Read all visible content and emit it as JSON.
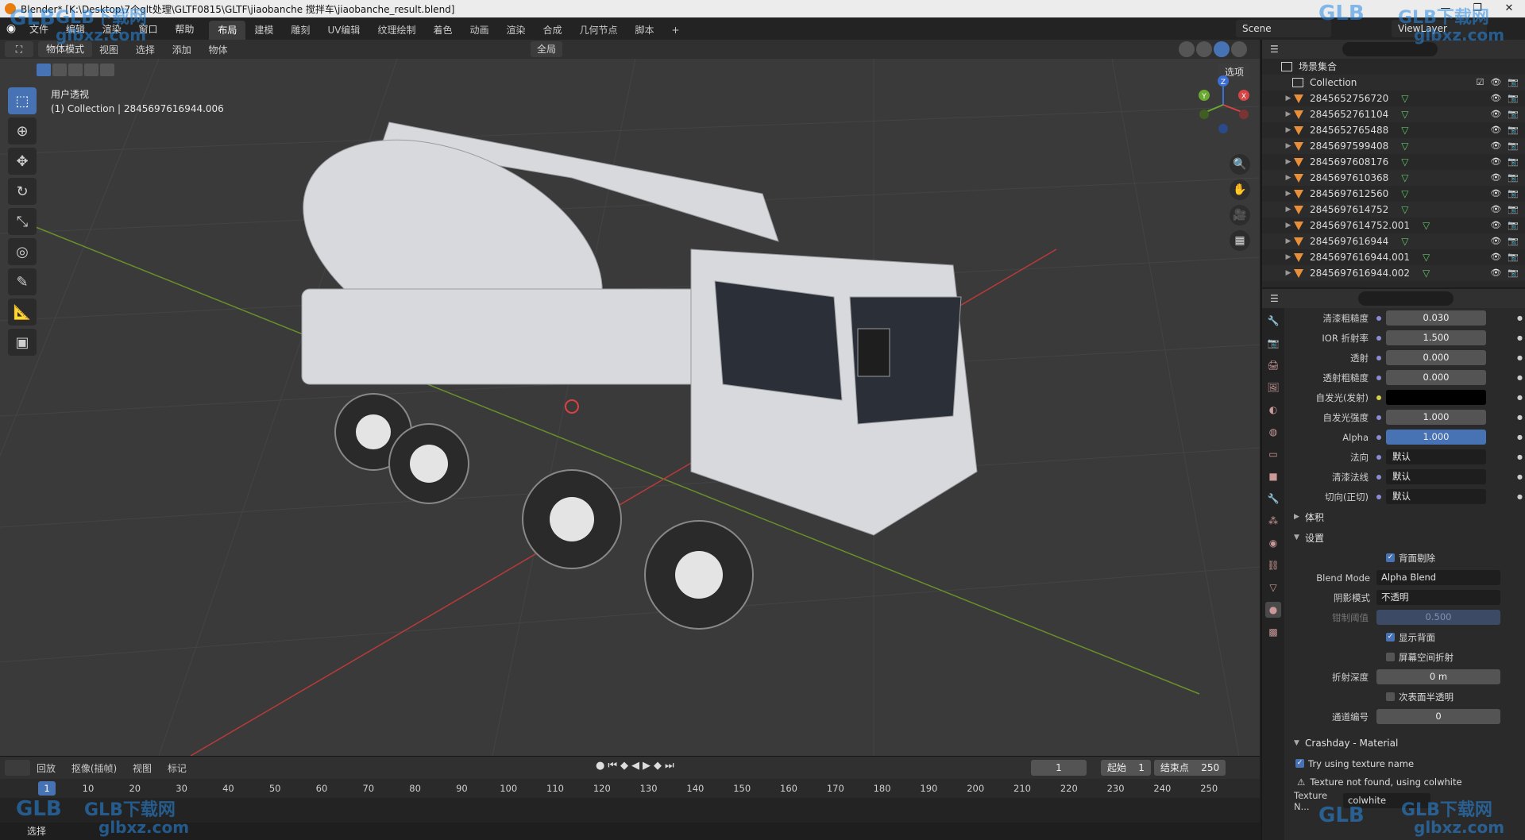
{
  "window": {
    "title": "Blender* [K:\\Desktop\\7个glt处理\\GLTF0815\\GLTF\\jiaobanche 搅拌车\\jiaobanche_result.blend]",
    "controls": [
      "—",
      "❐",
      "✕"
    ]
  },
  "topbar": {
    "menu": [
      "文件",
      "编辑",
      "渲染",
      "窗口",
      "帮助"
    ],
    "workspaces": [
      "布局",
      "建模",
      "雕刻",
      "UV编辑",
      "纹理绘制",
      "着色",
      "动画",
      "渲染",
      "合成",
      "几何节点",
      "脚本"
    ],
    "active_workspace": "布局",
    "add_tab": "+",
    "scene": "Scene",
    "view_layer": "ViewLayer"
  },
  "viewport_header": {
    "mode": "物体模式",
    "menu": [
      "视图",
      "选择",
      "添加",
      "物体"
    ],
    "transform_orientation": "全局",
    "options": "选项"
  },
  "viewport": {
    "view_name": "用户透视",
    "collection_info": "(1) Collection | 2845697616944.006",
    "gizmo_axes": [
      "X",
      "Y",
      "Z"
    ],
    "toolbar_icons": [
      "select-box-icon",
      "cursor-icon",
      "move-icon",
      "rotate-icon",
      "scale-icon",
      "transform-icon",
      "annotate-icon",
      "measure-icon",
      "add-cube-icon"
    ],
    "nav_icons": [
      "🔍",
      "✋",
      "🎥",
      "▦"
    ]
  },
  "outliner": {
    "root": "场景集合",
    "collection": "Collection",
    "items": [
      "2845652756720",
      "2845652761104",
      "2845652765488",
      "2845697599408",
      "2845697608176",
      "2845697610368",
      "2845697612560",
      "2845697614752",
      "2845697614752.001",
      "2845697616944",
      "2845697616944.001",
      "2845697616944.002"
    ]
  },
  "properties": {
    "fields": [
      {
        "label": "清漆粗糙度",
        "value": "0.030",
        "style": "grey"
      },
      {
        "label": "IOR 折射率",
        "value": "1.500",
        "style": "grey"
      },
      {
        "label": "透射",
        "value": "0.000",
        "style": "grey"
      },
      {
        "label": "透射粗糙度",
        "value": "0.000",
        "style": "grey"
      },
      {
        "label": "自发光(发射)",
        "value": "",
        "style": "black"
      },
      {
        "label": "自发光强度",
        "value": "1.000",
        "style": "grey"
      },
      {
        "label": "Alpha",
        "value": "1.000",
        "style": "blue"
      },
      {
        "label": "法向",
        "value": "默认",
        "style": "dark"
      },
      {
        "label": "清漆法线",
        "value": "默认",
        "style": "dark"
      },
      {
        "label": "切向(正切)",
        "value": "默认",
        "style": "dark"
      }
    ],
    "section_volume": "体积",
    "section_settings": "设置",
    "backface_culling": "背面剔除",
    "blend_mode_label": "Blend Mode",
    "blend_mode_value": "Alpha Blend",
    "shadow_mode_label": "阴影模式",
    "shadow_mode_value": "不透明",
    "clip_threshold_label": "钳制阈值",
    "clip_threshold_value": "0.500",
    "show_backface": "显示背面",
    "screen_space_refraction": "屏幕空间折射",
    "refraction_depth_label": "折射深度",
    "refraction_depth_value": "0 m",
    "subsurface_translucency": "次表面半透明",
    "pass_index_label": "通道编号",
    "pass_index_value": "0",
    "crashday_section": "Crashday - Material",
    "try_texture_name": "Try using texture name",
    "warning": "Texture not found, using colwhite",
    "texture_label": "Texture N...",
    "texture_value": "colwhite"
  },
  "timeline": {
    "menu": [
      "回放",
      "抠像(插帧)",
      "视图",
      "标记"
    ],
    "current_frame": "1",
    "start_label": "起始",
    "start_value": "1",
    "end_label": "结束点",
    "end_value": "250",
    "ruler": [
      "10",
      "20",
      "30",
      "40",
      "50",
      "60",
      "70",
      "80",
      "90",
      "100",
      "110",
      "120",
      "130",
      "140",
      "150",
      "160",
      "170",
      "180",
      "190",
      "200",
      "210",
      "220",
      "230",
      "240",
      "250"
    ],
    "ruler_current": "1"
  },
  "statusbar": {
    "text": "选择"
  },
  "watermarks": [
    "GLB下载网",
    "glbxz.com"
  ]
}
